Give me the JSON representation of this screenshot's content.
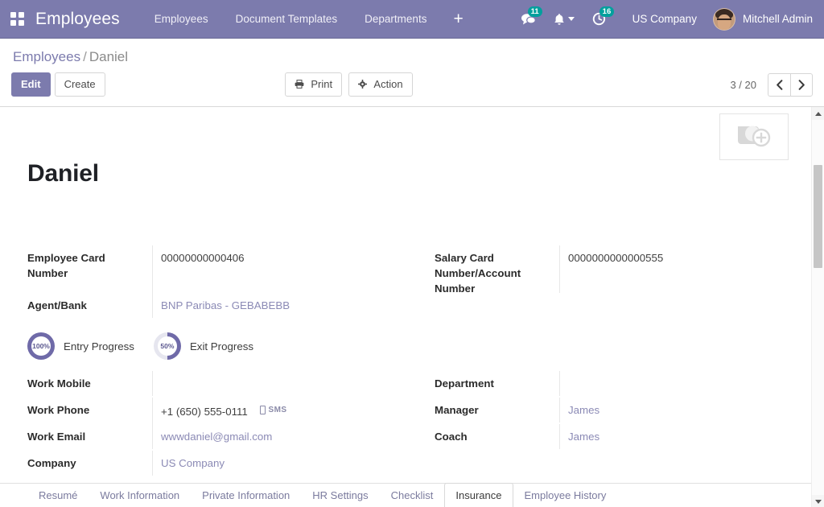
{
  "navbar": {
    "apps_icon": "apps-grid-icon",
    "brand": "Employees",
    "menu": [
      {
        "label": "Employees"
      },
      {
        "label": "Document Templates"
      },
      {
        "label": "Departments"
      }
    ],
    "plus_label": "+",
    "systray": {
      "messages_icon": "chat-bubble-icon",
      "messages_count": "11",
      "activities_icon": "bell-icon",
      "timer_icon": "clock-timer-icon",
      "timer_count": "16"
    },
    "company": "US Company",
    "user": "Mitchell Admin",
    "avatar_icon": "user-avatar",
    "accent": "#7c7bad",
    "badge_color": "#00a09d"
  },
  "control_panel": {
    "breadcrumb": {
      "root": "Employees",
      "separator": "/",
      "current": "Daniel"
    },
    "edit_label": "Edit",
    "create_label": "Create",
    "print_label": "Print",
    "print_icon": "printer-icon",
    "action_label": "Action",
    "action_icon": "gear-icon",
    "pager": "3 / 20",
    "prev_icon": "chevron-left-icon",
    "next_icon": "chevron-right-icon"
  },
  "form": {
    "image_placeholder_icon": "add-image-icon",
    "title": "Daniel",
    "left_fields": [
      {
        "label": "Employee Card Number",
        "value": "00000000000406",
        "style": "plain",
        "tall": true
      },
      {
        "label": "Agent/Bank",
        "value": "BNP Paribas - GEBABEBB",
        "style": "m2o",
        "tall": false
      }
    ],
    "right_fields": [
      {
        "label": "Salary Card Number/Account Number",
        "value": "0000000000000555",
        "style": "plain",
        "tall": true
      }
    ],
    "progress": [
      {
        "percent": "100%",
        "value": 100,
        "label": "Entry Progress"
      },
      {
        "percent": "50%",
        "value": 50,
        "label": "Exit Progress"
      }
    ],
    "contact_left": [
      {
        "label": "Work Mobile",
        "value": "",
        "style": "m2o",
        "sms": false
      },
      {
        "label": "Work Phone",
        "value": "+1 (650) 555-0111",
        "style": "plain",
        "sms": true,
        "sms_label": "SMS"
      },
      {
        "label": "Work Email",
        "value": "wwwdaniel@gmail.com",
        "style": "m2o",
        "sms": false
      },
      {
        "label": "Company",
        "value": "US Company",
        "style": "m2o",
        "sms": false
      }
    ],
    "contact_right": [
      {
        "label": "Department",
        "value": "",
        "style": "m2o"
      },
      {
        "label": "Manager",
        "value": "James",
        "style": "m2o"
      },
      {
        "label": "Coach",
        "value": "James",
        "style": "m2o"
      }
    ]
  },
  "notebook": {
    "tabs": [
      {
        "label": "Resumé",
        "active": false
      },
      {
        "label": "Work Information",
        "active": false
      },
      {
        "label": "Private Information",
        "active": false
      },
      {
        "label": "HR Settings",
        "active": false
      },
      {
        "label": "Checklist",
        "active": false
      },
      {
        "label": "Insurance",
        "active": true
      },
      {
        "label": "Employee History",
        "active": false
      }
    ]
  },
  "scrollbar": {
    "up_icon": "scroll-up-arrow-icon",
    "down_icon": "scroll-down-arrow-icon",
    "thumb": "scroll-thumb"
  }
}
